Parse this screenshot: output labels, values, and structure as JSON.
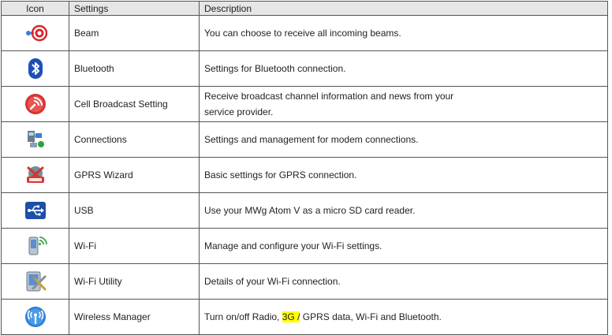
{
  "headers": {
    "icon": "Icon",
    "settings": "Settings",
    "description": "Description"
  },
  "rows": [
    {
      "icon": "beam-icon",
      "setting": "Beam",
      "description": "You can choose to receive all incoming beams."
    },
    {
      "icon": "bluetooth-icon",
      "setting": "Bluetooth",
      "description": "Settings for Bluetooth connection."
    },
    {
      "icon": "cell-broadcast-icon",
      "setting": "Cell Broadcast Setting",
      "description_line1": "Receive broadcast channel information and news from your",
      "description_line2": "service provider."
    },
    {
      "icon": "connections-icon",
      "setting": "Connections",
      "description": "Settings and management for modem connections."
    },
    {
      "icon": "gprs-wizard-icon",
      "setting": "GPRS Wizard",
      "description": "Basic settings for GPRS connection."
    },
    {
      "icon": "usb-icon",
      "setting": "USB",
      "description": "Use your MWg Atom V as a micro SD card reader."
    },
    {
      "icon": "wifi-icon",
      "setting": "Wi-Fi",
      "description": "Manage and configure your Wi-Fi settings."
    },
    {
      "icon": "wifi-utility-icon",
      "setting": "Wi-Fi Utility",
      "description": "Details of your Wi-Fi connection."
    },
    {
      "icon": "wireless-manager-icon",
      "setting": "Wireless Manager",
      "description_before": "Turn on/off Radio, ",
      "description_highlight": "3G /",
      "description_after": " GPRS data, Wi-Fi and Bluetooth."
    }
  ],
  "colors": {
    "highlight": "#ffff00",
    "header_bg": "#e6e6e6",
    "border": "#555555"
  }
}
